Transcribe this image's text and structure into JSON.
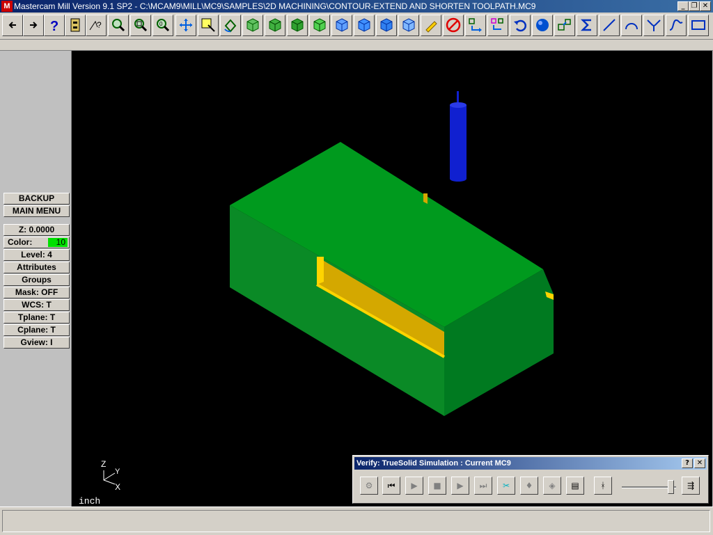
{
  "window": {
    "title": "Mastercam Mill Version 9.1 SP2 - C:\\MCAM9\\MILL\\MC9\\SAMPLES\\2D MACHINING\\CONTOUR-EXTEND AND SHORTEN TOOLPATH.MC9",
    "app_icon_text": "M",
    "minimize": "_",
    "restore": "❐",
    "close": "✕"
  },
  "toolbar": {
    "icons": [
      "back-arrow-icon",
      "forward-arrow-icon",
      "help-icon",
      "file-cabinet-icon",
      "analyze-icon",
      "zoom-window-icon",
      "unzoom-icon",
      "zoom-fit-icon",
      "pan-icon",
      "select-icon",
      "rotate-icon",
      "iso-view-icon",
      "front-view-icon",
      "right-view-icon",
      "top-view-icon",
      "cube-view-1-icon",
      "cube-view-2-icon",
      "cube-view-3-icon",
      "cube-view-4-icon",
      "pencil-icon",
      "no-entry-icon",
      "translate-icon",
      "multi-translate-icon",
      "undo-icon",
      "shade-sphere-icon",
      "group-icon",
      "sigma-icon",
      "line-icon",
      "arc-icon",
      "fillet-icon",
      "spline-icon",
      "rectangle-icon"
    ],
    "colors": {
      "green": "#00a000",
      "blue": "#0060e0",
      "red": "#e00000"
    }
  },
  "sidebar": {
    "backup": "BACKUP",
    "main_menu": "MAIN MENU",
    "z": "Z:  0.0000",
    "color_label": "Color:",
    "color_value": "10",
    "level": "Level:  4",
    "attributes": "Attributes",
    "groups": "Groups",
    "mask": "Mask:  OFF",
    "wcs": "WCS:   T",
    "tplane": "Tplane:  T",
    "cplane": "Cplane:  T",
    "gview": "Gview:   I"
  },
  "viewport": {
    "axis_z": "Z",
    "axis_y": "Y",
    "axis_x": "X",
    "units": "inch",
    "colors": {
      "background": "#000000",
      "part_top": "#009a1e",
      "part_left": "#0a8a26",
      "part_right": "#007a20",
      "pocket": "#d4a800",
      "pocket_edge": "#ffd400",
      "tool": "#1020d0"
    }
  },
  "verify": {
    "title": "Verify: TrueSolid Simulation : Current MC9",
    "help": "?",
    "close": "✕",
    "buttons": [
      "options-icon",
      "rewind-icon",
      "play-icon",
      "stop-icon",
      "step-icon",
      "fast-forward-icon",
      "cut-tool-icon",
      "show-tool-icon",
      "show-holder-icon",
      "save-stl-icon",
      "speed-slow-icon",
      "speed-fast-icon"
    ]
  }
}
